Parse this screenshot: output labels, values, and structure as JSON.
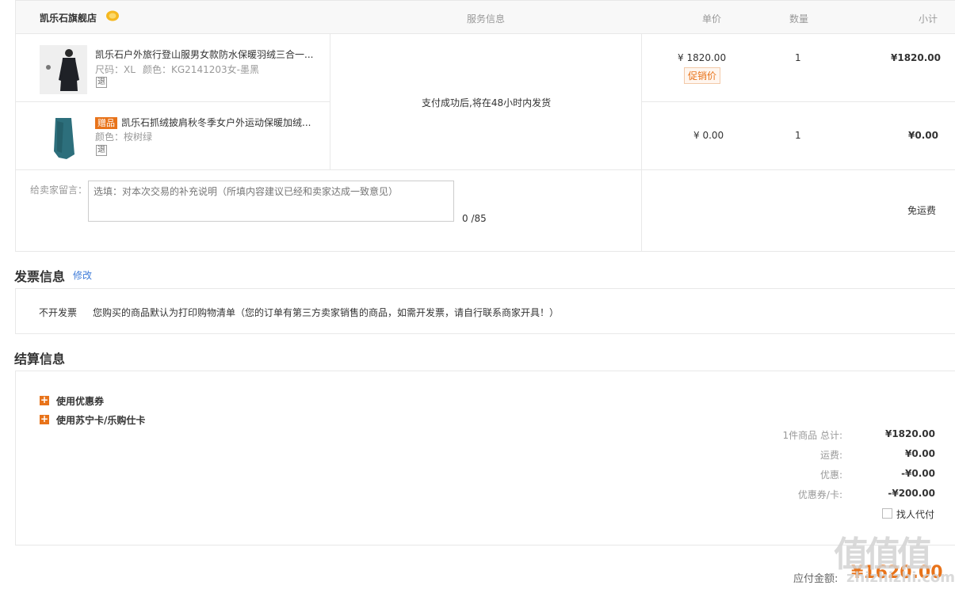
{
  "order": {
    "shop_name": "凯乐石旗舰店",
    "columns": {
      "service": "服务信息",
      "unit_price": "单价",
      "quantity": "数量",
      "subtotal": "小计"
    },
    "service_info": "支付成功后,将在48小时内发货",
    "items": [
      {
        "name": "凯乐石户外旅行登山服男女款防水保暖羽绒三合一...",
        "attr1": "尺码：XL",
        "attr2": "颜色：KG2141203女-墨黑",
        "refund_tag": "退",
        "price": "¥ 1820.00",
        "promo_tag": "促销价",
        "quantity": "1",
        "subtotal": "¥1820.00"
      },
      {
        "gift_tag": "赠品",
        "name": "凯乐石抓绒披肩秋冬季女户外运动保暖加绒...",
        "attr1": "颜色：桉树绿",
        "refund_tag": "退",
        "price": "¥ 0.00",
        "quantity": "1",
        "subtotal": "¥0.00"
      }
    ],
    "message_label": "给卖家留言：",
    "message_placeholder": "选填：对本次交易的补充说明（所填内容建议已经和卖家达成一致意见）",
    "message_count": "0 /85",
    "shipping": "免运费"
  },
  "invoice": {
    "title": "发票信息",
    "edit": "修改",
    "type": "不开发票",
    "note": "您购买的商品默认为打印购物清单（您的订单有第三方卖家销售的商品，如需开发票，请自行联系商家开具！）"
  },
  "settlement": {
    "title": "结算信息",
    "options": [
      "使用优惠券",
      "使用苏宁卡/乐购仕卡"
    ],
    "summary": [
      {
        "label": "1件商品 总计:",
        "value": "¥1820.00"
      },
      {
        "label": "运费:",
        "value": "¥0.00"
      },
      {
        "label": "优惠:",
        "value": "-¥0.00"
      },
      {
        "label": "优惠券/卡:",
        "value": "-¥200.00"
      }
    ],
    "proxy_pay": "找人代付",
    "payable_label": "应付金额:",
    "payable_value": "¥1620.00"
  },
  "watermark": {
    "glyphs": "值值值",
    "site": "zhizhizhi.com"
  },
  "colors": {
    "accent": "#e8731a",
    "link": "#3d7bd9",
    "border": "#e8e8e8"
  }
}
